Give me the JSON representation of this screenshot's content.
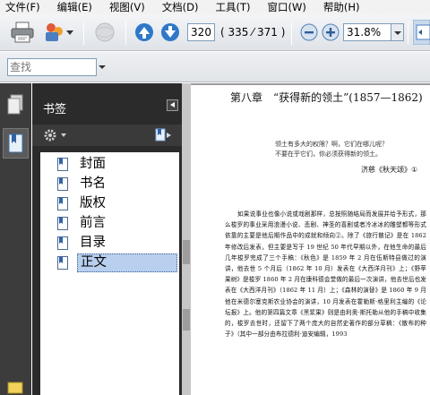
{
  "menubar": {
    "items": [
      "文件(F)",
      "编辑(E)",
      "视图(V)",
      "文档(D)",
      "工具(T)",
      "窗口(W)",
      "帮助(H)"
    ]
  },
  "toolbar": {
    "current_page": "320",
    "page_count": "( 335 ⁄ 371 )",
    "zoom": "31.8%"
  },
  "findbar": {
    "placeholder": "查找"
  },
  "panel": {
    "title": "书签",
    "bookmarks": [
      {
        "label": "封面"
      },
      {
        "label": "书名"
      },
      {
        "label": "版权"
      },
      {
        "label": "前言"
      },
      {
        "label": "目录"
      },
      {
        "label": "正文",
        "selected": true
      }
    ]
  },
  "document": {
    "chapter_title": "第八章　“获得新的领土”(1857—1862)",
    "epigraph_line1": "领土有多大的权限？啊，它们在哪儿呢？",
    "epigraph_line2": "不要在乎它们，你必须获得新的领土。",
    "epigraph_source": "济慈《秋天颂》①",
    "body": "如果说事业也像小说或戏剧那样，总按照随结局而发展并给予形式，那么梭罗的事业采用浪漫小说、悲剧、神圣的喜剧或者冷冰冰的雕塑都等形式依靠的主要是他后期作品中的成就和倾向②。除了《旅行散记》是在 1862 年修改后发表，但主要是写于 19 世纪 50 年代早期以外，在他生命的最后几年梭罗完成了三个手稿：《秋色》是 1859 年 2 月在伍斯特县做过的演讲，他去世 5 个月后（1862 年 10 月）发表在《大西洋月刊》上；《野苹果树》是梭罗 1860 年 2 月在康科德会堂做的最后一次演讲，他去世后也发表在《大西洋月刊》（1862 年 11 月）上；《森林的演替》是 1860 年 9 月他在米德尔塞克斯农业协会的演讲，10 月发表在霍勒斯·格里利主编的《论坛报》上。他的第四篇文章《黑浆果》则是由利奥·斯托勒从他的手稿中收集的，梭罗去世时，还留下了两个庞大的自然史著作的部分草稿：《散布的种子》（其中一部分由布拉德利·迪安编辑，1993"
  }
}
